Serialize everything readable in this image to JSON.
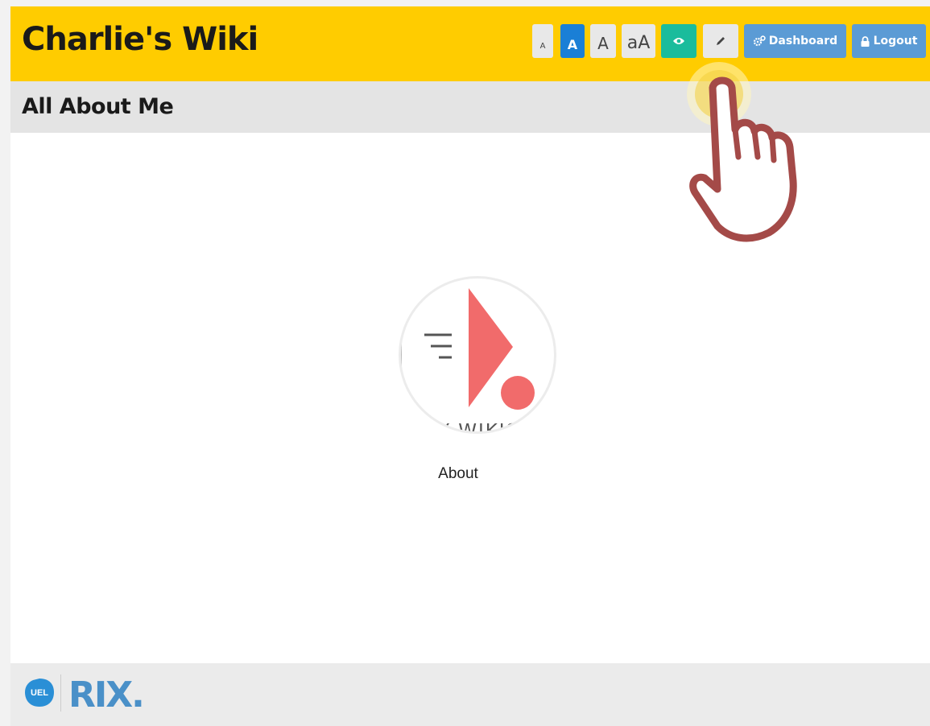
{
  "header": {
    "site_title": "Charlie's Wiki",
    "text_size_buttons": [
      "A",
      "A",
      "A",
      "aA"
    ],
    "dashboard_label": "Dashboard",
    "logout_label": "Logout"
  },
  "page": {
    "title": "All About Me"
  },
  "content": {
    "logo_text": "MY WIKIS",
    "about_label": "About"
  },
  "footer": {
    "uel_text": "UEL",
    "rix_text": "RIX."
  },
  "colors": {
    "header_bg": "#ffcc00",
    "subheader_bg": "#e4e4e4",
    "button_blue": "#5b9bd5",
    "active_size_blue": "#1a7fd6",
    "view_teal": "#1abc9c",
    "logo_coral": "#f16b6b",
    "hand_outline": "#a44a48"
  },
  "icons": [
    "eye-icon",
    "pencil-icon",
    "cogs-icon",
    "lock-icon",
    "hand-pointer-icon"
  ]
}
